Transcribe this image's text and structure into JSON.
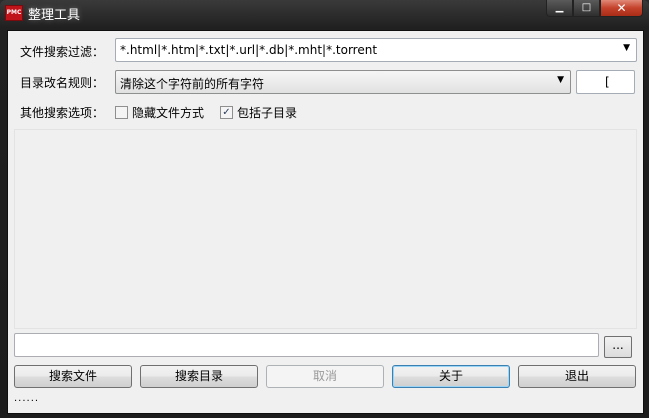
{
  "window": {
    "title": "整理工具",
    "icon_text": "PMC",
    "minimize": "▁",
    "maximize": "□",
    "close": "✕"
  },
  "filter": {
    "label": "文件搜索过滤：",
    "value": "*.html|*.htm|*.txt|*.url|*.db|*.mht|*.torrent"
  },
  "rename": {
    "label": "目录改名规则：",
    "value": "清除这个字符前的所有字符",
    "char": "["
  },
  "options": {
    "label": "其他搜索选项：",
    "hidden": {
      "label": "隐藏文件方式",
      "checked": false
    },
    "subdirs": {
      "label": "包括子目录",
      "checked": true,
      "mark": "✓"
    }
  },
  "path": {
    "value": "",
    "browse_label": "..."
  },
  "buttons": {
    "search_files": "搜索文件",
    "search_dirs": "搜索目录",
    "cancel": "取消",
    "about": "关于",
    "exit": "退出"
  },
  "status": "......",
  "arrow": "▼"
}
